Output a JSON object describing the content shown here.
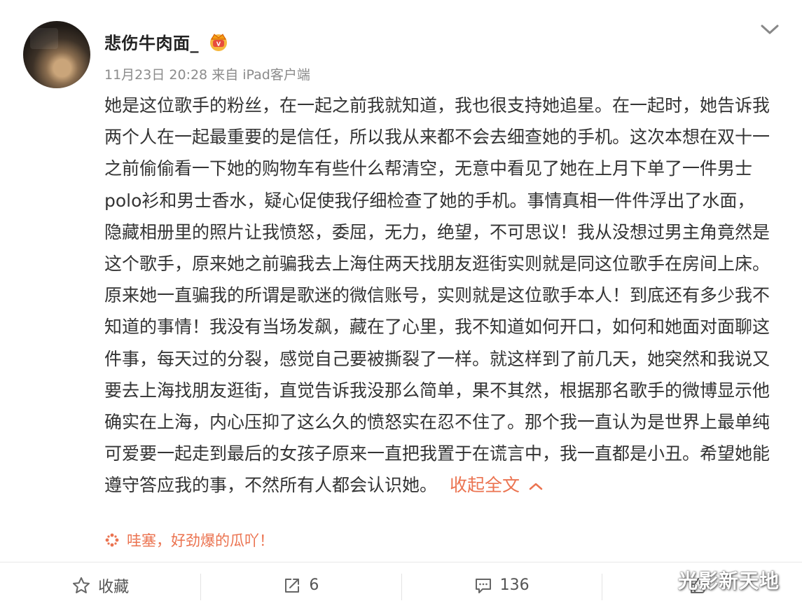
{
  "post": {
    "author": "悲伤牛肉面_",
    "meta": "11月23日 20:28 来自 iPad客户端",
    "content": "她是这位歌手的粉丝，在一起之前我就知道，我也很支持她追星。在一起时，她告诉我两个人在一起最重要的是信任，所以我从来都不会去细查她的手机。这次本想在双十一之前偷偷看一下她的购物车有些什么帮清空，无意中看见了她在上月下单了一件男士polo衫和男士香水，疑心促使我仔细检查了她的手机。事情真相一件件浮出了水面，隐藏相册里的照片让我愤怒，委屈，无力，绝望，不可思议！我从没想过男主角竟然是这个歌手，原来她之前骗我去上海住两天找朋友逛街实则就是同这位歌手在房间上床。原来她一直骗我的所谓是歌迷的微信账号，实则就是这位歌手本人！到底还有多少我不知道的事情！我没有当场发飙，藏在了心里，我不知道如何开口，如何和她面对面聊这件事，每天过的分裂，感觉自己要被撕裂了一样。就这样到了前几天，她突然和我说又要去上海找朋友逛街，直觉告诉我没那么简单，果不其然，根据那名歌手的微博显示他确实在上海，内心压抑了这么久的愤怒实在忍不住了。那个我一直认为是世界上最单纯可爱要一起走到最后的女孩子原来一直把我置于在谎言中，我一直都是小丑。希望她能遵守答应我的事，不然所有人都会认识她。",
    "collapse_label": "收起全文",
    "tagline": "哇塞，好劲爆的瓜吖！"
  },
  "actions": {
    "favorite": "收藏",
    "repost": "6",
    "comment": "136",
    "like": ""
  },
  "watermark": "光影新天地",
  "colors": {
    "accent": "#eb7350",
    "text": "#333333",
    "meta": "#8b8b8b"
  },
  "icons": {
    "badge": "crown-badge-icon",
    "top_menu": "chevron-down-icon",
    "collapse": "chevron-up-icon",
    "tag": "sparkle-icon",
    "favorite": "star-icon",
    "repost": "repost-icon",
    "comment": "comment-icon",
    "like": "like-icon"
  }
}
